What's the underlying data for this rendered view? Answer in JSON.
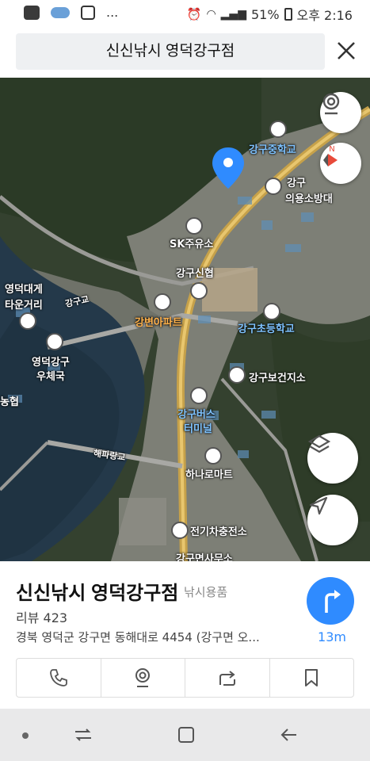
{
  "status": {
    "battery": "51%",
    "time": "오후 2:16",
    "notif_more": "..."
  },
  "search": {
    "query": "신신낚시 영덕강구점"
  },
  "map": {
    "pois": [
      {
        "label": "강구중학교",
        "color": "blue"
      },
      {
        "label": "강구",
        "color": "white"
      },
      {
        "label": "의용소방대",
        "color": "white"
      },
      {
        "label": "SK주유소",
        "color": "white"
      },
      {
        "label": "강구신협",
        "color": "white"
      },
      {
        "label": "영덕대게",
        "color": "white"
      },
      {
        "label": "타운거리",
        "color": "white"
      },
      {
        "label": "강변아파트",
        "color": "orange"
      },
      {
        "label": "강구초등학교",
        "color": "blue"
      },
      {
        "label": "영덕강구",
        "color": "white"
      },
      {
        "label": "우체국",
        "color": "white"
      },
      {
        "label": "강구보건지소",
        "color": "white"
      },
      {
        "label": "강구버스",
        "color": "blue"
      },
      {
        "label": "터미널",
        "color": "blue"
      },
      {
        "label": "하나로마트",
        "color": "white"
      },
      {
        "label": "전기차충전소",
        "color": "white"
      },
      {
        "label": "강구면사무소",
        "color": "white"
      },
      {
        "label": "농협",
        "color": "white"
      }
    ],
    "bridge_labels": [
      "강구교",
      "해파랑교"
    ],
    "compass_label": "N"
  },
  "place": {
    "name": "신신낚시 영덕강구점",
    "category": "낚시용품",
    "review": "리뷰 423",
    "address": "경북 영덕군 강구면 동해대로 4454 (강구면 오...",
    "distance": "13m"
  },
  "actions": {
    "call_icon": "phone-icon",
    "roadview_icon": "roadview-icon",
    "share_icon": "share-icon",
    "save_icon": "bookmark-icon"
  },
  "colors": {
    "accent": "#2f8bff",
    "pin": "#2f8bff",
    "compass_red": "#e84a3a"
  }
}
